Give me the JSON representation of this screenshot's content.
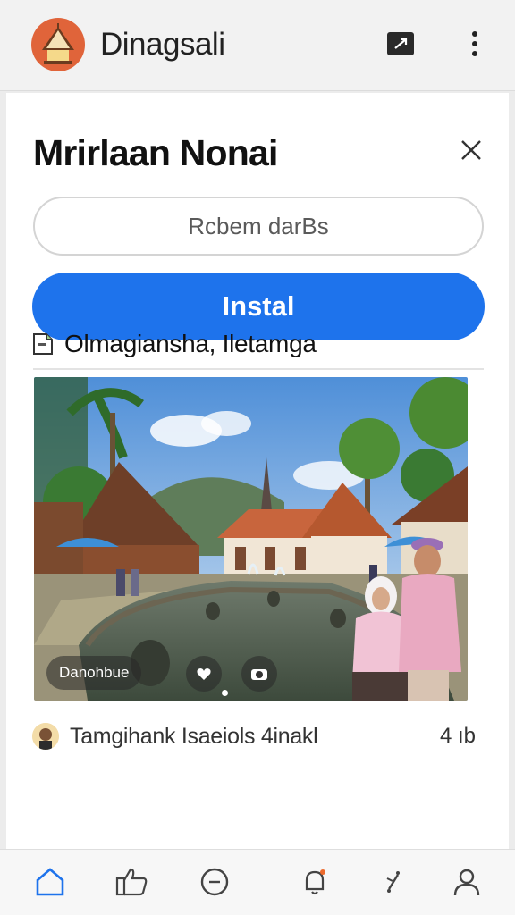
{
  "app": {
    "name": "Dinagsali",
    "logo_icon": "temple-logo-icon"
  },
  "topbar": {
    "cast_icon": "cast-icon",
    "more_icon": "more-vertical-icon"
  },
  "sheet": {
    "title": "Mrirlaan Nonai",
    "close_icon": "close-icon",
    "input_placeholder": "Rcbem darBs",
    "install_label": "Instal"
  },
  "post": {
    "location_icon": "document-icon",
    "location": "Olmagiansha, Iletamga",
    "photo_caption": "Danohbue",
    "comment_author_avatar": "avatar",
    "comment_text": "Tamgihank Isaeiols 4inakl",
    "comment_time": "4 ıb"
  },
  "colors": {
    "accent": "#1e73ec",
    "logo_orange": "#e0643a"
  },
  "bottom_nav": {
    "items": [
      "home-icon",
      "like-icon",
      "clock-icon",
      "notification-icon",
      "share-icon",
      "profile-icon"
    ]
  }
}
